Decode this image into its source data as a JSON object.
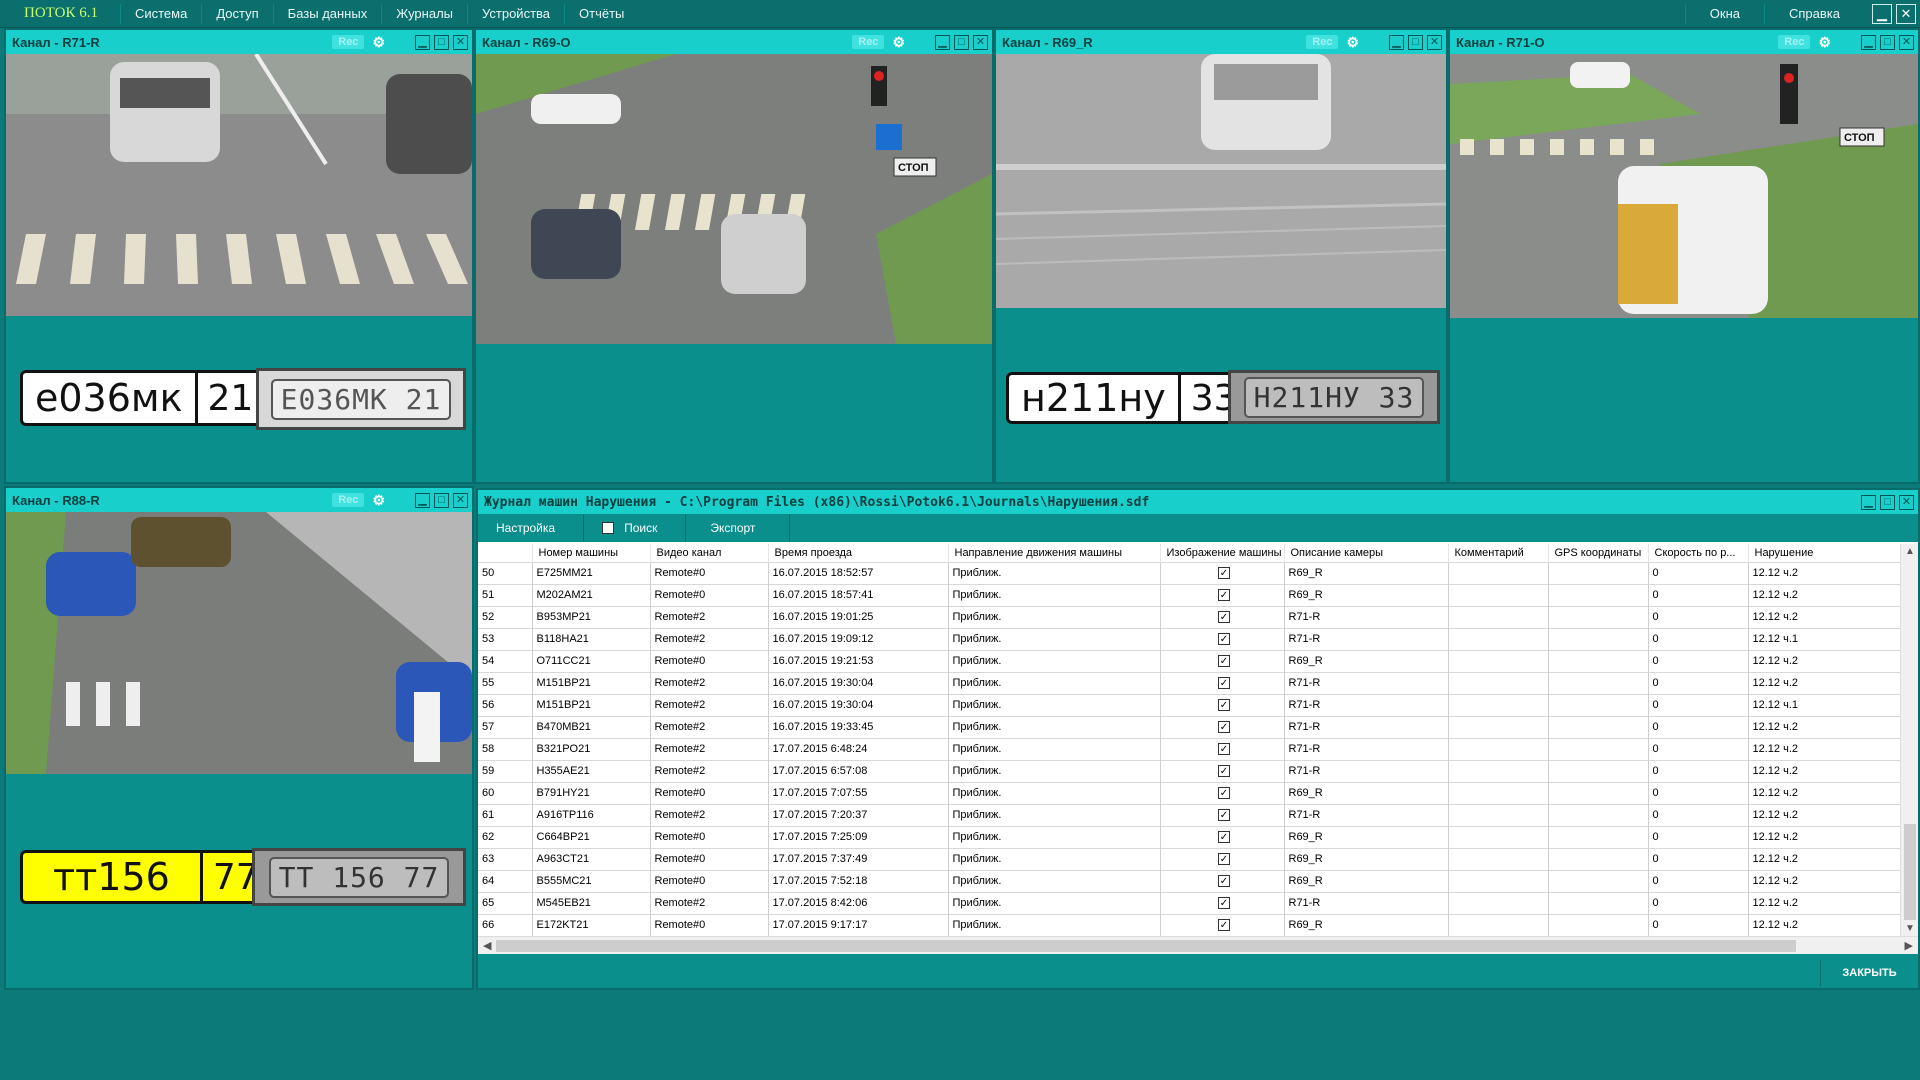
{
  "app": {
    "brand": "ПОТОК 6.1",
    "menu": [
      "Система",
      "Доступ",
      "Базы данных",
      "Журналы",
      "Устройства",
      "Отчёты"
    ],
    "right_menu": [
      "Окна",
      "Справка"
    ]
  },
  "panels": [
    {
      "title": "Канал - R71-R",
      "rec": "Rec",
      "plate_num": "е036мк",
      "plate_reg": "21",
      "photo_text": "Е036МК 21"
    },
    {
      "title": "Канал - R69-O",
      "rec": "Rec"
    },
    {
      "title": "Канал - R69_R",
      "rec": "Rec",
      "plate_num": "н211ну",
      "plate_reg": "33",
      "photo_text": "Н211НУ 33"
    },
    {
      "title": "Канал - R71-O",
      "rec": "Rec"
    },
    {
      "title": "Канал - R88-R",
      "rec": "Rec",
      "plate_num": "тт156",
      "plate_reg": "77",
      "photo_text": "ТТ 156 77"
    }
  ],
  "scene_text": {
    "stop": "СТОП"
  },
  "journal": {
    "title": "Журнал машин Нарушения - C:\\Program Files (x86)\\Rossi\\Potok6.1\\Journals\\Нарушения.sdf",
    "toolbar": [
      "Настройка",
      "Поиск",
      "Экспорт"
    ],
    "close_label": "ЗАКРЫТЬ",
    "columns": [
      "",
      "Номер машины",
      "Видео канал",
      "Время проезда",
      "Направление движения машины",
      "Изображение машины",
      "Описание камеры",
      "Комментарий",
      "GPS координаты",
      "Скорость по р...",
      "Нарушение"
    ],
    "rows": [
      [
        "50",
        "E725MM21",
        "Remote#0",
        "16.07.2015 18:52:57",
        "Приближ.",
        "✓",
        "R69_R",
        "",
        "",
        "0",
        "12.12 ч.2"
      ],
      [
        "51",
        "M202AM21",
        "Remote#0",
        "16.07.2015 18:57:41",
        "Приближ.",
        "✓",
        "R69_R",
        "",
        "",
        "0",
        "12.12 ч.2"
      ],
      [
        "52",
        "B953MP21",
        "Remote#2",
        "16.07.2015 19:01:25",
        "Приближ.",
        "✓",
        "R71-R",
        "",
        "",
        "0",
        "12.12 ч.2"
      ],
      [
        "53",
        "B118HA21",
        "Remote#2",
        "16.07.2015 19:09:12",
        "Приближ.",
        "✓",
        "R71-R",
        "",
        "",
        "0",
        "12.12 ч.1"
      ],
      [
        "54",
        "O711CC21",
        "Remote#0",
        "16.07.2015 19:21:53",
        "Приближ.",
        "✓",
        "R69_R",
        "",
        "",
        "0",
        "12.12 ч.2"
      ],
      [
        "55",
        "M151BP21",
        "Remote#2",
        "16.07.2015 19:30:04",
        "Приближ.",
        "✓",
        "R71-R",
        "",
        "",
        "0",
        "12.12 ч.2"
      ],
      [
        "56",
        "M151BP21",
        "Remote#2",
        "16.07.2015 19:30:04",
        "Приближ.",
        "✓",
        "R71-R",
        "",
        "",
        "0",
        "12.12 ч.1"
      ],
      [
        "57",
        "B470MB21",
        "Remote#2",
        "16.07.2015 19:33:45",
        "Приближ.",
        "✓",
        "R71-R",
        "",
        "",
        "0",
        "12.12 ч.2"
      ],
      [
        "58",
        "B321PO21",
        "Remote#2",
        "17.07.2015 6:48:24",
        "Приближ.",
        "✓",
        "R71-R",
        "",
        "",
        "0",
        "12.12 ч.2"
      ],
      [
        "59",
        "H355AE21",
        "Remote#2",
        "17.07.2015 6:57:08",
        "Приближ.",
        "✓",
        "R71-R",
        "",
        "",
        "0",
        "12.12 ч.2"
      ],
      [
        "60",
        "B791HY21",
        "Remote#0",
        "17.07.2015 7:07:55",
        "Приближ.",
        "✓",
        "R69_R",
        "",
        "",
        "0",
        "12.12 ч.2"
      ],
      [
        "61",
        "A916TP116",
        "Remote#2",
        "17.07.2015 7:20:37",
        "Приближ.",
        "✓",
        "R71-R",
        "",
        "",
        "0",
        "12.12 ч.2"
      ],
      [
        "62",
        "C664BP21",
        "Remote#0",
        "17.07.2015 7:25:09",
        "Приближ.",
        "✓",
        "R69_R",
        "",
        "",
        "0",
        "12.12 ч.2"
      ],
      [
        "63",
        "A963CT21",
        "Remote#0",
        "17.07.2015 7:37:49",
        "Приближ.",
        "✓",
        "R69_R",
        "",
        "",
        "0",
        "12.12 ч.2"
      ],
      [
        "64",
        "B555MC21",
        "Remote#0",
        "17.07.2015 7:52:18",
        "Приближ.",
        "✓",
        "R69_R",
        "",
        "",
        "0",
        "12.12 ч.2"
      ],
      [
        "65",
        "M545EB21",
        "Remote#2",
        "17.07.2015 8:42:06",
        "Приближ.",
        "✓",
        "R71-R",
        "",
        "",
        "0",
        "12.12 ч.2"
      ],
      [
        "66",
        "E172KT21",
        "Remote#0",
        "17.07.2015 9:17:17",
        "Приближ.",
        "✓",
        "R69_R",
        "",
        "",
        "0",
        "12.12 ч.2"
      ]
    ]
  },
  "colors": {
    "background": "#0b7a78",
    "titlebar": "#19cfcc",
    "panel": "#0b8f8c",
    "brand": "#c9ff6a",
    "plate_yellow": "#ffff00"
  },
  "icons": [
    "gear-icon",
    "minimize-icon",
    "maximize-icon",
    "close-icon"
  ]
}
